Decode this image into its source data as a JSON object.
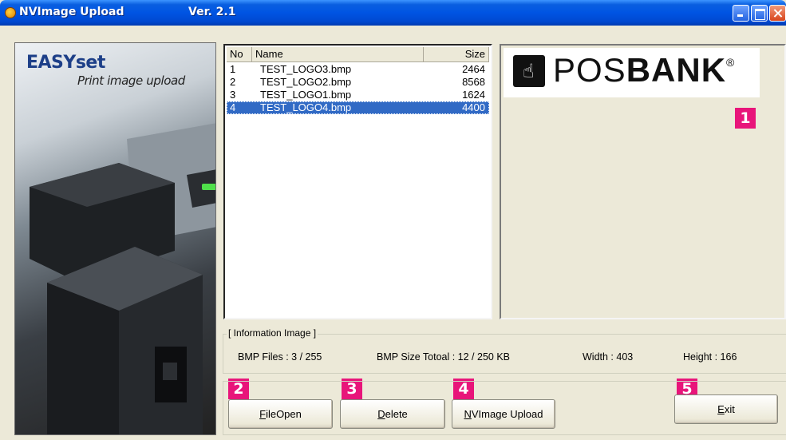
{
  "window": {
    "title": "NVImage Upload",
    "version": "Ver. 2.1",
    "min_icon": "minimize-icon",
    "max_icon": "maximize-icon",
    "close_icon": "close-icon"
  },
  "promo": {
    "logo": "EASYset",
    "subtitle": "Print image upload"
  },
  "file_list": {
    "columns": [
      "No",
      "Name",
      "Size"
    ],
    "rows": [
      {
        "no": "1",
        "name": "TEST_LOGO3.bmp",
        "size": "2464"
      },
      {
        "no": "2",
        "name": "TEST_LOGO2.bmp",
        "size": "8568"
      },
      {
        "no": "3",
        "name": "TEST_LOGO1.bmp",
        "size": "1624"
      },
      {
        "no": "4",
        "name": "TEST_LOGO4.bmp",
        "size": "4400"
      }
    ],
    "selected_index": 3
  },
  "preview": {
    "brand_light": "POS",
    "brand_bold": "BANK",
    "brand_mark": "®"
  },
  "badges": [
    "1",
    "2",
    "3",
    "4",
    "5"
  ],
  "info": {
    "legend": "[ Information Image ]",
    "bmp_files": "BMP Files : 3 / 255",
    "bmp_size": "BMP Size Totoal : 12 / 250 KB",
    "width": "Width : 403",
    "height": "Height : 166"
  },
  "buttons": {
    "file_open_u": "F",
    "file_open_rest": "ileOpen",
    "delete_u": "D",
    "delete_rest": "elete",
    "upload_u": "N",
    "upload_rest": "VImage Upload",
    "exit_u": "E",
    "exit_rest": "xit"
  },
  "colors": {
    "selection": "#316ac5",
    "badge": "#e8157a",
    "titlebar": "#0054e3"
  }
}
